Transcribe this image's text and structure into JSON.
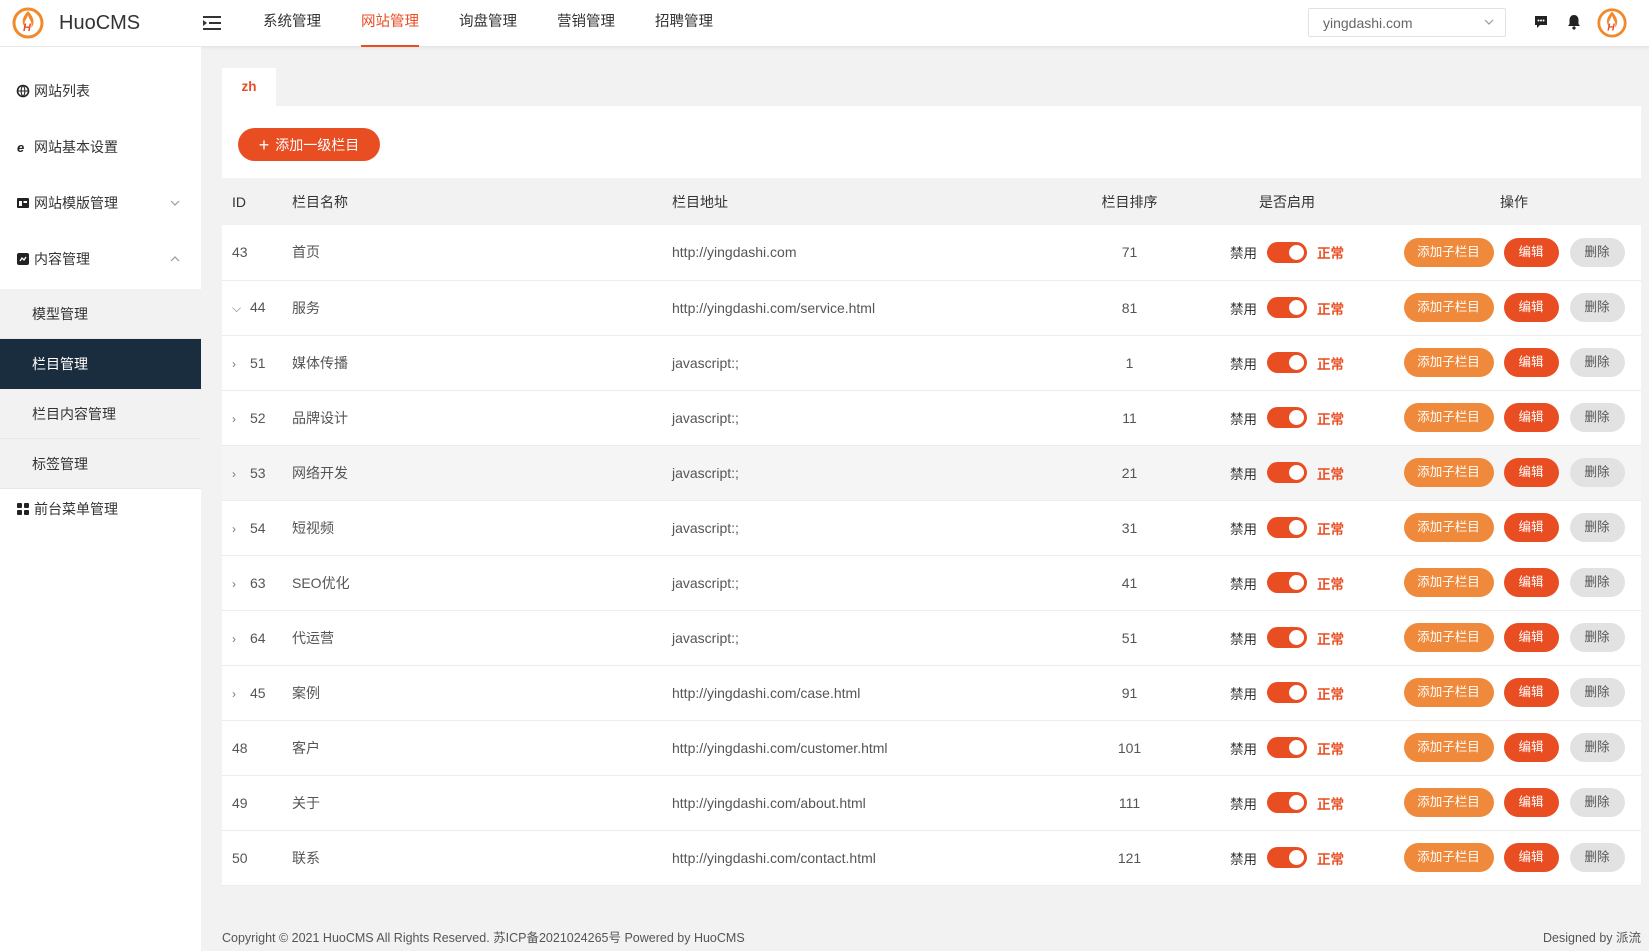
{
  "app": {
    "brand": "HuoCMS"
  },
  "topnav": [
    {
      "label": "系统管理",
      "active": false
    },
    {
      "label": "网站管理",
      "active": true
    },
    {
      "label": "询盘管理",
      "active": false
    },
    {
      "label": "营销管理",
      "active": false
    },
    {
      "label": "招聘管理",
      "active": false
    }
  ],
  "site_select": {
    "value": "yingdashi.com"
  },
  "sidebar": {
    "items": [
      {
        "label": "网站列表",
        "icon": "globe-icon"
      },
      {
        "label": "网站基本设置",
        "icon": "ie-icon"
      },
      {
        "label": "网站模版管理",
        "icon": "template-icon"
      },
      {
        "label": "内容管理",
        "icon": "content-icon"
      },
      {
        "label": "前台菜单管理",
        "icon": "grid-icon"
      }
    ],
    "sub_items": [
      {
        "label": "模型管理"
      },
      {
        "label": "栏目管理"
      },
      {
        "label": "栏目内容管理"
      },
      {
        "label": "标签管理"
      }
    ]
  },
  "tabs": [
    {
      "label": "zh"
    }
  ],
  "add_button": {
    "label": "添加一级栏目",
    "icon": "plus-icon"
  },
  "table": {
    "headers": {
      "id": "ID",
      "name": "栏目名称",
      "url": "栏目地址",
      "sort": "栏目排序",
      "status": "是否启用",
      "ops": "操作"
    },
    "status_off": "禁用",
    "status_on": "正常",
    "ops": {
      "add": "添加子栏目",
      "edit": "编辑",
      "delete": "删除"
    },
    "rows": [
      {
        "id": "43",
        "name": "首页",
        "url": "http://yingdashi.com",
        "sort": "71",
        "expand": ""
      },
      {
        "id": "44",
        "name": "服务",
        "url": "http://yingdashi.com/service.html",
        "sort": "81",
        "expand": "⌵"
      },
      {
        "id": "51",
        "name": "媒体传播",
        "url": "javascript:;",
        "sort": "1",
        "expand": "›"
      },
      {
        "id": "52",
        "name": "品牌设计",
        "url": "javascript:;",
        "sort": "11",
        "expand": "›"
      },
      {
        "id": "53",
        "name": "网络开发",
        "url": "javascript:;",
        "sort": "21",
        "expand": "›"
      },
      {
        "id": "54",
        "name": "短视频",
        "url": "javascript:;",
        "sort": "31",
        "expand": "›"
      },
      {
        "id": "63",
        "name": "SEO优化",
        "url": "javascript:;",
        "sort": "41",
        "expand": "›"
      },
      {
        "id": "64",
        "name": "代运营",
        "url": "javascript:;",
        "sort": "51",
        "expand": "›"
      },
      {
        "id": "45",
        "name": "案例",
        "url": "http://yingdashi.com/case.html",
        "sort": "91",
        "expand": "›"
      },
      {
        "id": "48",
        "name": "客户",
        "url": "http://yingdashi.com/customer.html",
        "sort": "101",
        "expand": ""
      },
      {
        "id": "49",
        "name": "关于",
        "url": "http://yingdashi.com/about.html",
        "sort": "111",
        "expand": ""
      },
      {
        "id": "50",
        "name": "联系",
        "url": "http://yingdashi.com/contact.html",
        "sort": "121",
        "expand": ""
      }
    ]
  },
  "footer": {
    "left": "Copyright © 2021 HuoCMS All Rights Reserved. 苏ICP备2021024265号 Powered by HuoCMS",
    "right": "Designed by 派流"
  },
  "colors": {
    "accent": "#e94d22",
    "accent_light": "#ef8a3c",
    "sidebar_active": "#1a2d3f"
  }
}
